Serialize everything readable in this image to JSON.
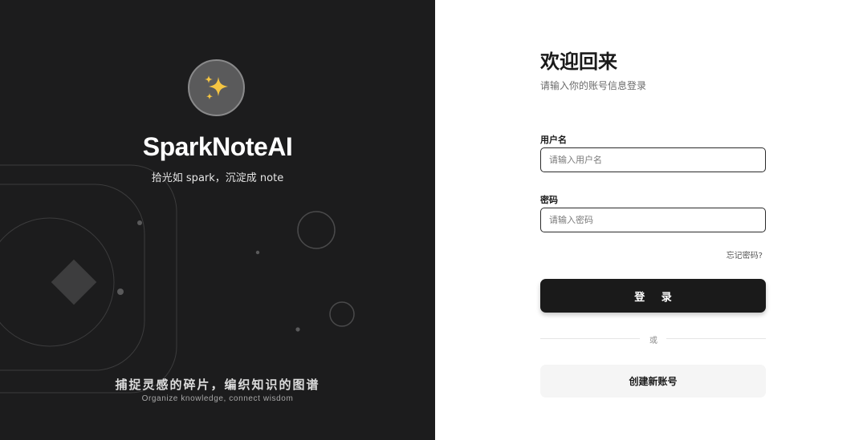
{
  "brand_panel": {
    "logo_icon": "sparkles-icon",
    "brand_name": "SparkNoteAI",
    "tagline": "拾光如 spark，沉淀成 note",
    "slogan_cn": "捕捉灵感的碎片，编织知识的图谱",
    "slogan_en": "Organize knowledge, connect wisdom",
    "background_color": "#1c1c1d"
  },
  "login_form": {
    "title": "欢迎回来",
    "subtitle": "请输入你的账号信息登录",
    "username": {
      "label": "用户名",
      "placeholder": "请输入用户名",
      "value": ""
    },
    "password": {
      "label": "密码",
      "placeholder": "请输入密码",
      "value": ""
    },
    "forgot_password": "忘记密码?",
    "login_button": "登 录",
    "divider_text": "或",
    "register_button": "创建新账号",
    "accent_color": "#1a1a1a"
  }
}
